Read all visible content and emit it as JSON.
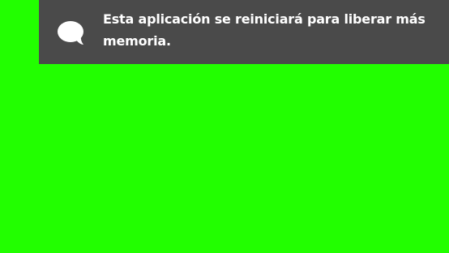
{
  "screen": {
    "background_color": "#22ff00"
  },
  "notification": {
    "background_color": "#4a4a4a",
    "text_color": "#ffffff",
    "icon": "speech-bubble-icon",
    "message": "Esta aplicación se reiniciará para liberar más memoria."
  }
}
